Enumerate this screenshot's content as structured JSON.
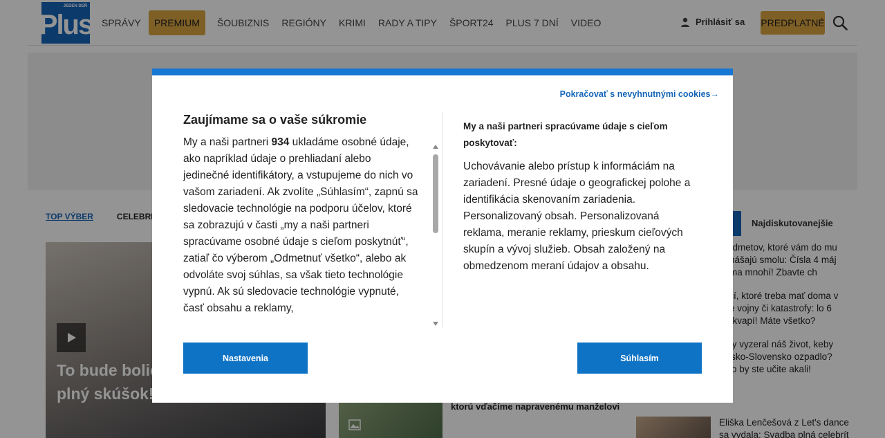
{
  "header": {
    "logo_text": "Plus",
    "logo_tagline": "JEDEN DEŇ",
    "nav": [
      "SPRÁVY",
      "PREMIUM",
      "ŠOUBIZNIS",
      "REGIÓNY",
      "KRIMI",
      "RADY A TIPY",
      "ŠPORT24",
      "PLUS 7 DNÍ",
      "VIDEO"
    ],
    "login_label": "Prihlásiť sa",
    "subscribe_label": "PREDPLATNÉ",
    "accent_color": "#d9a441",
    "brand_color": "#1565b8"
  },
  "page": {
    "tabs": [
      "TOP VÝBER",
      "CELEBRITY"
    ],
    "side_tab_label": "Najdiskutovanejšie",
    "hero_title": "To bude bolie varovanie od rok plný skúšok! Zvládne to?",
    "mid_article": "ktorú vďačíme napravenému manželovi",
    "side_items": [
      "predmetov, ktoré vám do mu prinášajú smolu: Čísla 4 máj doma mnohí! Zbavte ch",
      "vecí, ktoré treba mať doma v ade vojny či katastrofy: lo 6 prekvapí! Máte všetko?",
      "o by vyzeral náš život, keby Česko-Slovensko ozpadlo? Toto by ste učite akali!"
    ],
    "side_last": "Eliška Lenčešová z Let's dance sa vydala: Svadba plná celebrít"
  },
  "consent": {
    "continue_link": "Pokračovať s nevyhnutnými cookies→",
    "title": "Zaujímame sa o vaše súkromie",
    "body_before": "My a naši partneri ",
    "partner_count": "934",
    "body_after": " ukladáme osobné údaje, ako napríklad údaje o prehliadaní alebo jedinečné identifikátory, a vstupujeme do nich vo vašom zariadení. Ak zvolíte „Súhlasím“, zapnú sa sledovacie technológie na podporu účelov, ktoré sa zobrazujú v časti „my a naši partneri spracúvame osobné údaje s cieľom poskytnúť“, zatiaľ čo výberom „Odmetnuť všetko“, alebo ak odvoláte svoj súhlas, sa však tieto technológie vypnú. Ak sú sledovacie technológie vypnuté, časť obsahu a reklamy,",
    "right_heading": "My a naši partneri spracúvame údaje s cieľom poskytovať:",
    "right_text": "Uchovávanie alebo prístup k informáciám na zariadení. Presné údaje o geografickej polohe a identifikácia skenovaním zariadenia. Personalizovaný obsah. Personalizovaná reklama, meranie reklamy, prieskum cieľových skupín a vývoj služieb. Obsah založený na obmedzenom meraní údajov a obsahu.",
    "settings_button": "Nastavenia",
    "agree_button": "Súhlasím",
    "button_color": "#0f73c5"
  }
}
